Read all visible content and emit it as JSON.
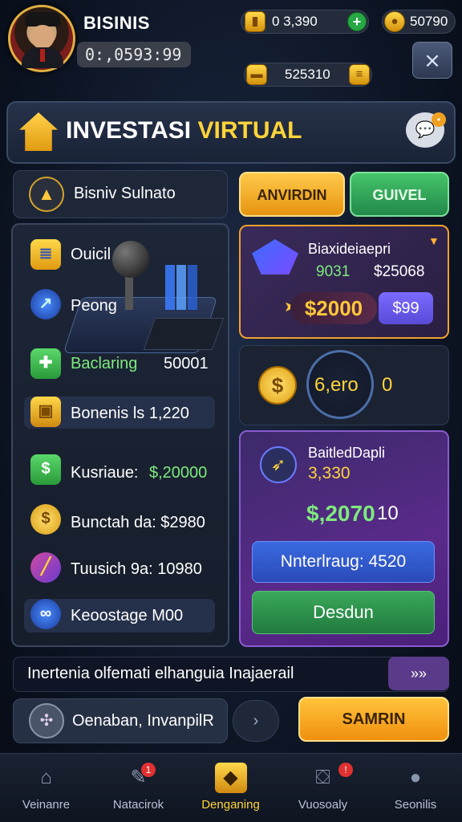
{
  "header": {
    "player_name": "BISINIS",
    "player_id": "0:,0593:99",
    "currency_1": "0  3,390",
    "currency_2": "50790",
    "currency_3": "525310",
    "close_label": "⨯"
  },
  "title": {
    "part1": "INVESTASI",
    "part2": "VIRTUAL"
  },
  "left": {
    "header_title": "Bisniv Sulnato",
    "items": [
      {
        "label": "Ouicil",
        "icon": "document-icon"
      },
      {
        "label": "Peong",
        "icon": "compass-icon"
      },
      {
        "label": "Baclaring",
        "value": "50001",
        "icon": "chart-icon"
      },
      {
        "label": "Bonenis ls 1,220",
        "icon": "box-icon"
      },
      {
        "label": "Kusriaue:",
        "value": "$,20000",
        "icon": "cash-stack-icon"
      },
      {
        "label": "Bunctah da: $2980",
        "icon": "coin-icon"
      },
      {
        "label": "Tuusich 9a: 10980",
        "icon": "stripe-icon"
      },
      {
        "label": "Keoostage M00",
        "icon": "link-icon"
      }
    ]
  },
  "tabs": {
    "tab1": "ANVIRDIN",
    "tab2": "GUIVEL"
  },
  "card1": {
    "title": "Biaxideiaepri",
    "stat_left": "9031",
    "stat_right": "$25068",
    "price": "$2000",
    "button": "$99"
  },
  "card2": {
    "value": "6,ero",
    "extra": "0"
  },
  "card3": {
    "title": "BaitledDapli",
    "subtitle": "3,330",
    "amount": "$,2070",
    "amount_extra": "10",
    "blue_button": "Nnterlraug: 4520",
    "green_button": "Desdun"
  },
  "ticker": {
    "text": "Inertenia olfemati elhanguia Inajaerail",
    "button": "»»"
  },
  "search": {
    "text": "Oenaban, InvanpilR"
  },
  "nav_arrows": "›",
  "submit": "SAMRIN",
  "bottom_nav": [
    {
      "label": "Veinanre",
      "icon": "home-icon"
    },
    {
      "label": "Natacirok",
      "icon": "tools-icon",
      "badge": "1"
    },
    {
      "label": "Denganing",
      "icon": "invest-icon"
    },
    {
      "label": "Vuosoaly",
      "icon": "basket-icon",
      "badge": "!"
    },
    {
      "label": "Seonilis",
      "icon": "profile-icon"
    }
  ],
  "colors": {
    "accent": "#ffd43a",
    "green": "#3aa85a",
    "purple": "#5a2a8a"
  }
}
